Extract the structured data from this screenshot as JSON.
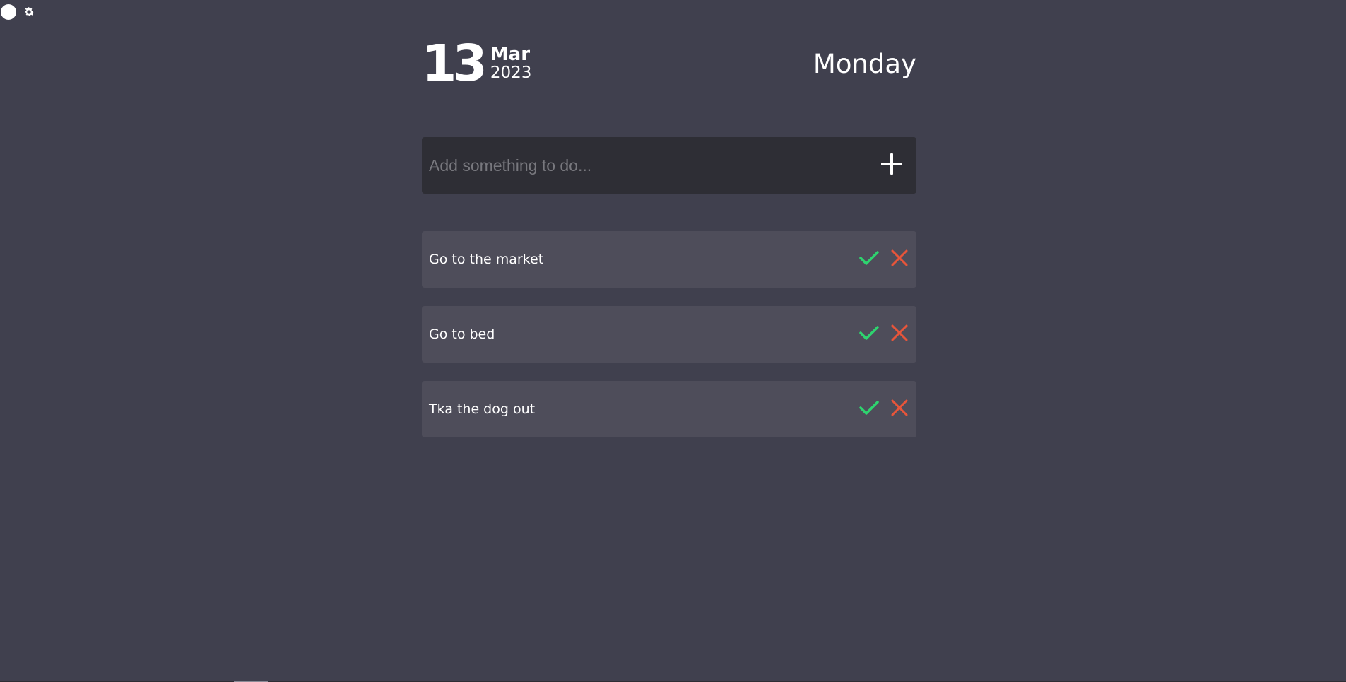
{
  "header": {
    "day": "13",
    "month": "Mar",
    "year": "2023",
    "weekday": "Monday"
  },
  "toggle": {
    "knob_icon": "circle-knob",
    "settings_icon": "gear-icon"
  },
  "add_task": {
    "placeholder": "Add something to do...",
    "value": "",
    "button_icon": "plus-icon"
  },
  "tasks": [
    {
      "label": "Go to the market"
    },
    {
      "label": "Go to bed"
    },
    {
      "label": "Tka the dog out"
    }
  ],
  "colors": {
    "background": "#40404e",
    "input_background": "#2e2e35",
    "task_background": "#4e4d5a",
    "check": "#2ed46f",
    "delete": "#e8553a"
  }
}
